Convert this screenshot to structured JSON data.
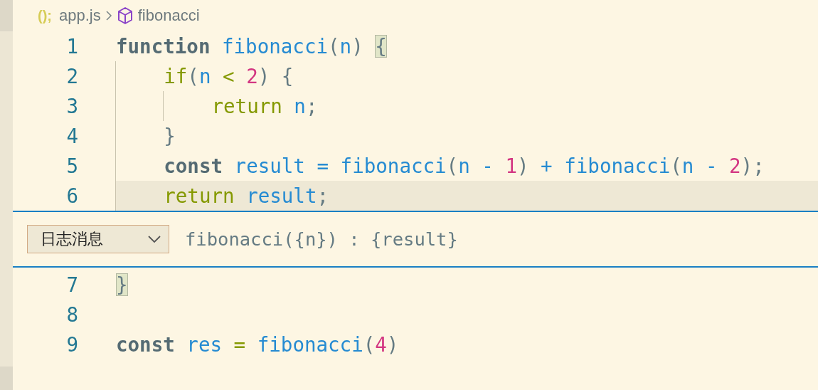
{
  "breadcrumb": {
    "file_icon": "();",
    "file": "app.js",
    "symbol": "fibonacci"
  },
  "editor_top": [
    {
      "number": "1",
      "highlighted": false,
      "tokens": [
        {
          "text": "function",
          "kind": "kw"
        },
        {
          "text": " fibonacci",
          "kind": "fn"
        },
        {
          "text": "(",
          "kind": "punct"
        },
        {
          "text": "n",
          "kind": "var"
        },
        {
          "text": ") ",
          "kind": "punct"
        },
        {
          "text": "{",
          "kind": "punct",
          "matched": true
        }
      ]
    },
    {
      "number": "2",
      "highlighted": false,
      "tokens": [
        {
          "text": "    if",
          "kind": "ctl"
        },
        {
          "text": "(",
          "kind": "punct"
        },
        {
          "text": "n",
          "kind": "var"
        },
        {
          "text": " <",
          "kind": "op"
        },
        {
          "text": " 2",
          "kind": "num"
        },
        {
          "text": ") {",
          "kind": "punct"
        }
      ]
    },
    {
      "number": "3",
      "highlighted": false,
      "tokens": [
        {
          "text": "        return",
          "kind": "ctl"
        },
        {
          "text": " n",
          "kind": "var"
        },
        {
          "text": ";",
          "kind": "punct"
        }
      ]
    },
    {
      "number": "4",
      "highlighted": false,
      "tokens": [
        {
          "text": "    }",
          "kind": "punct"
        }
      ]
    },
    {
      "number": "5",
      "highlighted": false,
      "tokens": [
        {
          "text": "    const",
          "kind": "kw"
        },
        {
          "text": " result = fibonacci",
          "kind": "var"
        },
        {
          "text": "(",
          "kind": "punct"
        },
        {
          "text": "n - ",
          "kind": "var"
        },
        {
          "text": "1",
          "kind": "num"
        },
        {
          "text": ") ",
          "kind": "punct"
        },
        {
          "text": "+ fibonacci",
          "kind": "var"
        },
        {
          "text": "(",
          "kind": "punct"
        },
        {
          "text": "n - ",
          "kind": "var"
        },
        {
          "text": "2",
          "kind": "num"
        },
        {
          "text": ");",
          "kind": "punct"
        }
      ]
    },
    {
      "number": "6",
      "highlighted": true,
      "tokens": [
        {
          "text": "    return",
          "kind": "ctl"
        },
        {
          "text": " result",
          "kind": "var"
        },
        {
          "text": ";",
          "kind": "punct"
        }
      ]
    }
  ],
  "log_widget": {
    "type": "日志消息",
    "value": "fibonacci({n}) : {result}"
  },
  "editor_bottom": [
    {
      "number": "7",
      "highlighted": false,
      "tokens": [
        {
          "text": "}",
          "kind": "punct",
          "matched": true
        }
      ]
    },
    {
      "number": "8",
      "highlighted": false
    },
    {
      "number": "9",
      "highlighted": false,
      "tokens": [
        {
          "text": "const",
          "kind": "kw"
        },
        {
          "text": " res",
          "kind": "var"
        },
        {
          "text": " =",
          "kind": "op"
        },
        {
          "text": " fibonacci",
          "kind": "fn"
        },
        {
          "text": "(",
          "kind": "punct"
        },
        {
          "text": "4",
          "kind": "num"
        },
        {
          "text": ")",
          "kind": "punct"
        }
      ]
    }
  ]
}
